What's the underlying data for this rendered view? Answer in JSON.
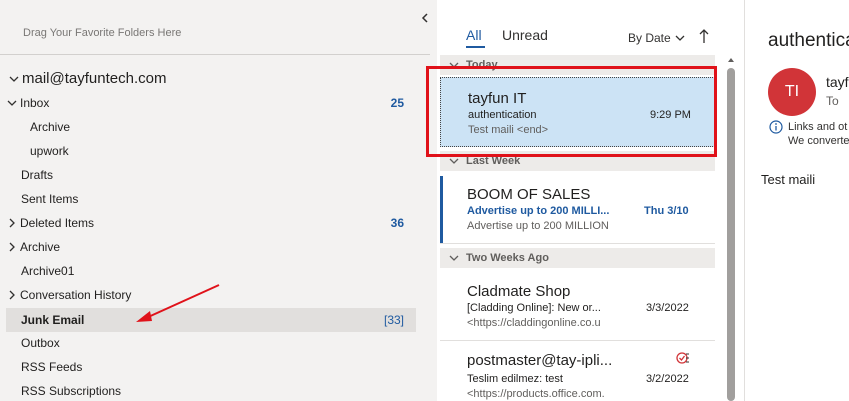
{
  "favorites_hint": "Drag Your Favorite Folders Here",
  "account": "mail@tayfuntech.com",
  "folders": [
    {
      "name": "Inbox",
      "count": "25",
      "expanded": true
    },
    {
      "name": "Archive",
      "count": ""
    },
    {
      "name": "upwork",
      "count": ""
    },
    {
      "name": "Drafts",
      "count": ""
    },
    {
      "name": "Sent Items",
      "count": ""
    },
    {
      "name": "Deleted Items",
      "count": "36"
    },
    {
      "name": "Archive",
      "count": ""
    },
    {
      "name": "Archive01",
      "count": ""
    },
    {
      "name": "Conversation History",
      "count": ""
    },
    {
      "name": "Junk Email",
      "count": "[33]"
    },
    {
      "name": "Outbox",
      "count": ""
    },
    {
      "name": "RSS Feeds",
      "count": ""
    },
    {
      "name": "RSS Subscriptions",
      "count": ""
    }
  ],
  "list": {
    "tab_all": "All",
    "tab_unread": "Unread",
    "sort_label": "By Date",
    "groups": [
      "Today",
      "Last Week",
      "Two Weeks Ago"
    ],
    "messages": [
      {
        "sender": "tayfun IT",
        "subject": "authentication",
        "time": "9:29 PM",
        "preview": "Test maili <end>"
      },
      {
        "sender": "BOOM OF SALES",
        "subject": "Advertise up to 200 MILLI...",
        "time": "Thu 3/10",
        "preview": "Advertise up to 200 MILLION"
      },
      {
        "sender": "Cladmate Shop",
        "subject": "[Cladding Online]: New or...",
        "time": "3/3/2022",
        "preview": "<https://claddingonline.co.u"
      },
      {
        "sender": "postmaster@tay-ipli...",
        "subject": "Teslim edilmez: test",
        "time": "3/2/2022",
        "preview": "<https://products.office.com."
      }
    ]
  },
  "reading": {
    "subject": "authentica",
    "avatar_initials": "TI",
    "from": "tayf",
    "to": "To",
    "info_line1": "Links and ot",
    "info_line2": "We converte",
    "body": "Test maili"
  },
  "colors": {
    "accent": "#1f5aa0",
    "selected_message": "#cce3f5",
    "highlight_box": "#e0121a",
    "avatar": "#d13438"
  }
}
